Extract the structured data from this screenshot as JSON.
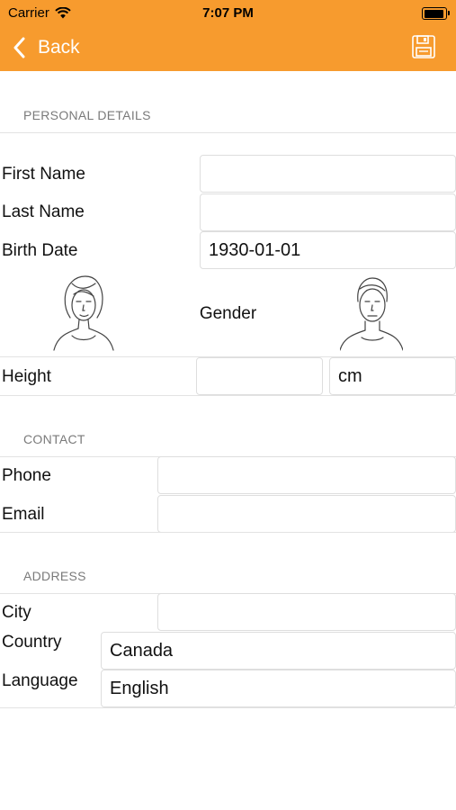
{
  "status": {
    "carrier": "Carrier",
    "time": "7:07 PM",
    "battery_level": 0.95
  },
  "nav": {
    "back_label": "Back"
  },
  "personal": {
    "header": "PERSONAL DETAILS",
    "first_name_label": "First Name",
    "first_name_value": "",
    "last_name_label": "Last Name",
    "last_name_value": "",
    "birth_date_label": "Birth Date",
    "birth_date_value": "1930-01-01",
    "gender_label": "Gender",
    "height_label": "Height",
    "height_value": "",
    "height_unit": "cm"
  },
  "contact": {
    "header": "CONTACT",
    "phone_label": "Phone",
    "phone_value": "",
    "email_label": "Email",
    "email_value": ""
  },
  "address": {
    "header": "ADDRESS",
    "city_label": "City",
    "city_value": "",
    "country_label": "Country",
    "country_value": "Canada",
    "language_label": "Language",
    "language_value": "English"
  },
  "colors": {
    "header_bg": "#F79B2E",
    "icon_on_header": "#FFFFFF"
  },
  "icons": {
    "back": "chevron-left-icon",
    "save": "floppy-disk-icon",
    "female": "female-face-icon",
    "male": "male-face-icon",
    "wifi": "wifi-icon",
    "battery": "battery-icon"
  }
}
